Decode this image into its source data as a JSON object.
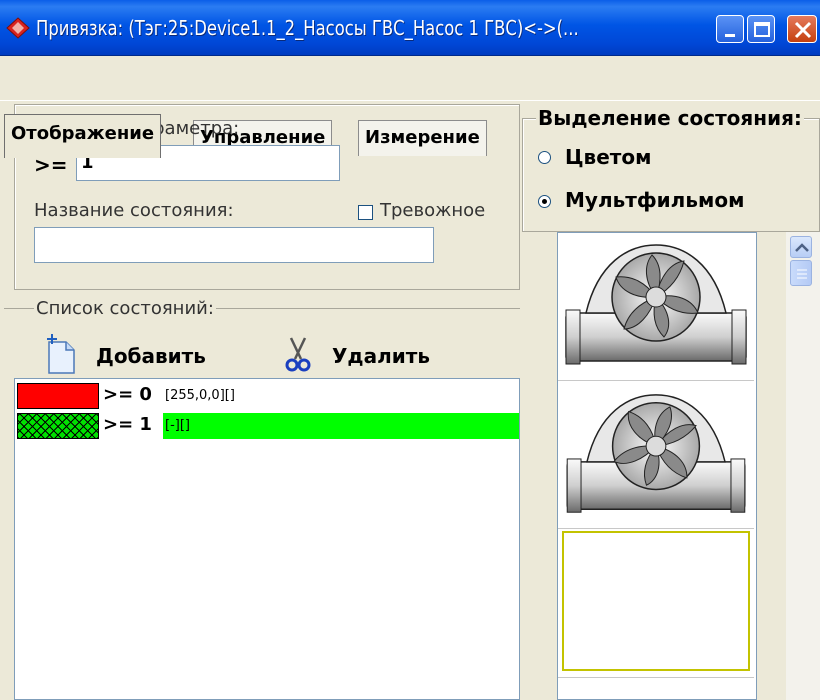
{
  "window": {
    "title": "Привязка: (Тэг:25:Device1.1_2_Насосы ГВС_Насос 1 ГВС)<->(...",
    "app_icon": "red-diamond-icon",
    "controls": [
      "minimize-icon",
      "maximize-icon",
      "close-icon"
    ]
  },
  "tabs": [
    {
      "label": "Отображение",
      "active": true
    },
    {
      "label": "Управление",
      "active": false
    },
    {
      "label": "Измерение",
      "active": false
    }
  ],
  "param": {
    "label": "Значение параметра:",
    "operator": ">=",
    "value": "1",
    "state_name_label": "Название состояния:",
    "state_name_value": "",
    "alarm_label": "Тревожное",
    "alarm_checked": false
  },
  "highlight": {
    "title": "Выделение состояния:",
    "options": [
      {
        "label": "Цветом",
        "selected": false
      },
      {
        "label": "Мультфильмом",
        "selected": true
      }
    ]
  },
  "states": {
    "title": "Список состояний:",
    "add_label": "Добавить",
    "delete_label": "Удалить",
    "rows": [
      {
        "condition": ">= 0",
        "value": "[255,0,0][]",
        "swatch_color": "#ff0000",
        "hatched": false,
        "highlight_color": ""
      },
      {
        "condition": ">= 1",
        "value": "[-][]",
        "swatch_color": "#00e000",
        "hatched": true,
        "highlight_color": "#00ff00"
      }
    ]
  },
  "preview": {
    "cells": [
      {
        "icon": "pump-fan-icon",
        "selected": false
      },
      {
        "icon": "pump-fan-icon",
        "selected": false
      },
      {
        "icon": "",
        "selected": true
      },
      {
        "icon": "",
        "selected": false
      }
    ]
  },
  "colors": {
    "titlebar": "#0055e5",
    "dialog_bg": "#ece9d8",
    "alarm_red": "#ff0000",
    "active_green": "#00ff00",
    "selection_border": "#c3c300"
  }
}
